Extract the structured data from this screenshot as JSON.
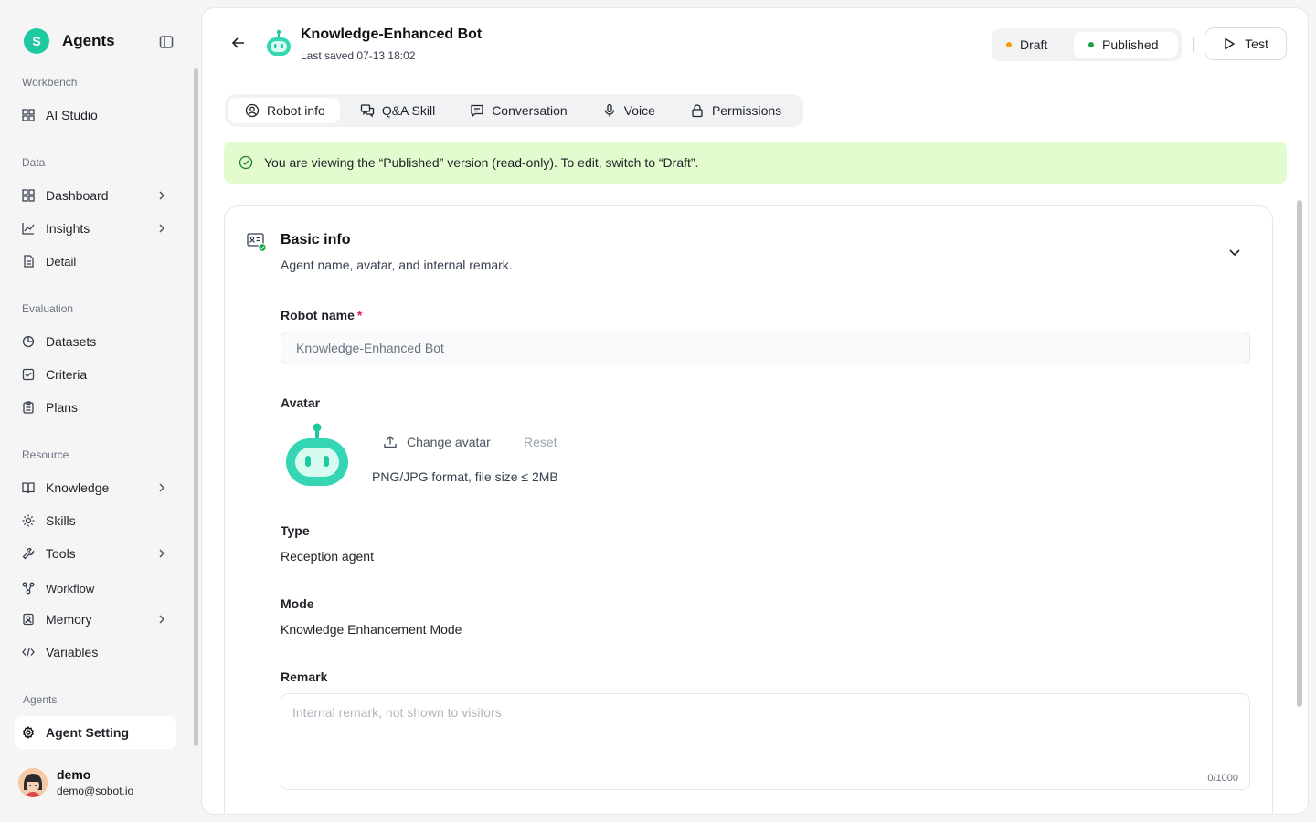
{
  "app": {
    "name": "Agents",
    "logo_letter": "S"
  },
  "sidebar": {
    "sections": {
      "workbench": "Workbench",
      "data": "Data",
      "evaluation": "Evaluation",
      "resource": "Resource",
      "agents": "Agents"
    },
    "items": {
      "ai_studio": "AI Studio",
      "dashboard": "Dashboard",
      "insights": "Insights",
      "detail": "Detail",
      "datasets": "Datasets",
      "criteria": "Criteria",
      "plans": "Plans",
      "knowledge": "Knowledge",
      "skills": "Skills",
      "tools": "Tools",
      "workflow": "Workflow",
      "memory": "Memory",
      "variables": "Variables",
      "agent_setting": "Agent Setting"
    },
    "user": {
      "name": "demo",
      "email": "demo@sobot.io"
    }
  },
  "header": {
    "title": "Knowledge-Enhanced Bot",
    "last_saved": "Last saved 07-13 18:02",
    "draft_label": "Draft",
    "published_label": "Published",
    "test_label": "Test"
  },
  "tabs": {
    "robot_info": "Robot info",
    "qa_skill": "Q&A Skill",
    "conversation": "Conversation",
    "voice": "Voice",
    "permissions": "Permissions"
  },
  "banner": {
    "text": "You are viewing the “Published” version (read-only). To edit, switch to “Draft”."
  },
  "basic_info": {
    "title": "Basic info",
    "description": "Agent name, avatar, and internal remark.",
    "robot_name_label": "Robot name",
    "required_mark": "*",
    "robot_name_value": "Knowledge-Enhanced Bot",
    "avatar_label": "Avatar",
    "change_avatar": "Change avatar",
    "reset": "Reset",
    "avatar_hint": "PNG/JPG format, file size ≤ 2MB",
    "type_label": "Type",
    "type_value": "Reception agent",
    "mode_label": "Mode",
    "mode_value": "Knowledge Enhancement Mode",
    "remark_label": "Remark",
    "remark_placeholder": "Internal remark, not shown to visitors",
    "remark_counter": "0/1000"
  },
  "colors": {
    "brand": "#1ec9a2",
    "draft_dot": "#f59e0b",
    "published_dot": "#16a34a",
    "banner_bg": "#e3fccf",
    "required": "#e11d48"
  }
}
